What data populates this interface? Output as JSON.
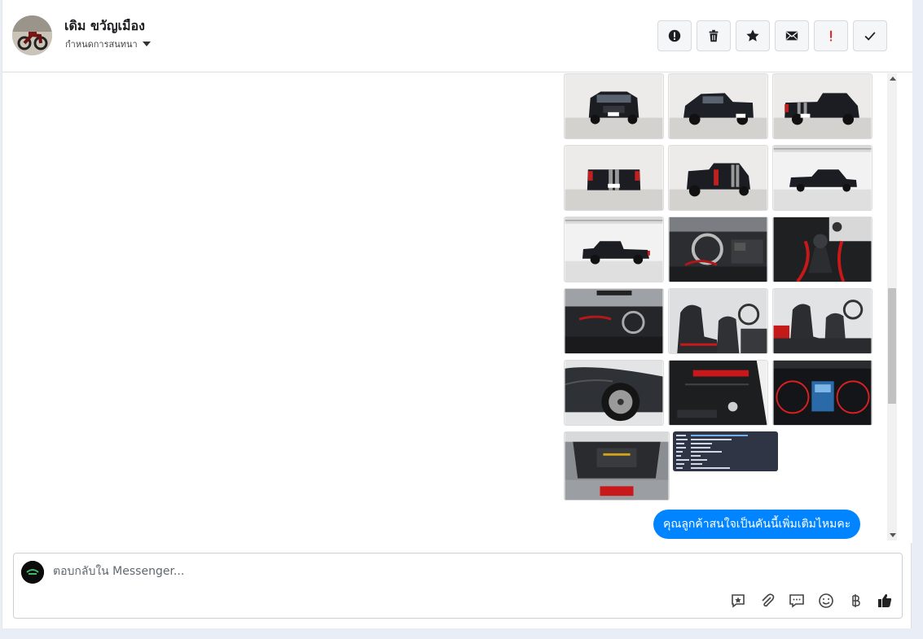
{
  "header": {
    "contact_name": "เดิม ขวัญเมือง",
    "subtitle": "กำหนดการสนทนา",
    "actions": [
      {
        "name": "report-button",
        "icon": "exclamation-circle-icon"
      },
      {
        "name": "delete-button",
        "icon": "trash-icon"
      },
      {
        "name": "star-button",
        "icon": "star-icon"
      },
      {
        "name": "mark-unread-button",
        "icon": "envelope-icon"
      },
      {
        "name": "flag-button",
        "icon": "red-exclamation-icon"
      },
      {
        "name": "mark-done-button",
        "icon": "checkmark-icon"
      }
    ]
  },
  "messages": {
    "photos": [
      {
        "name": "photo-front"
      },
      {
        "name": "photo-front-side"
      },
      {
        "name": "photo-rear-side"
      },
      {
        "name": "photo-rear"
      },
      {
        "name": "photo-rear-quarter"
      },
      {
        "name": "photo-side-showroom"
      },
      {
        "name": "photo-side-profile"
      },
      {
        "name": "photo-dashboard"
      },
      {
        "name": "photo-gear-shift"
      },
      {
        "name": "photo-cabin"
      },
      {
        "name": "photo-front-seats"
      },
      {
        "name": "photo-seats-side"
      },
      {
        "name": "photo-wheel"
      },
      {
        "name": "photo-door-panel"
      },
      {
        "name": "photo-gauges"
      },
      {
        "name": "photo-engine"
      },
      {
        "name": "photo-spec-sheet"
      }
    ],
    "last_message": "คุณลูกค้าสนใจเป็นคันนี้เพิ่มเติมไหมคะ"
  },
  "composer": {
    "placeholder": "ตอบกลับใน Messenger...",
    "tools": [
      "saved-reply-icon",
      "attachment-icon",
      "chat-bubble-icon",
      "emoji-icon",
      "baht-icon",
      "thumbs-up-icon"
    ]
  },
  "colors": {
    "accent": "#0084ff",
    "flag": "#e02020"
  }
}
